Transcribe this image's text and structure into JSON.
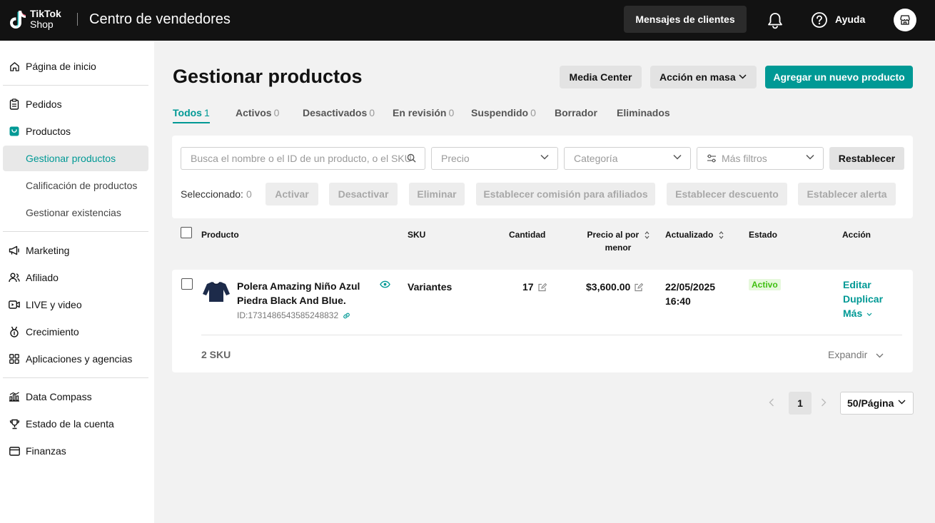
{
  "header": {
    "logo_top": "TikTok",
    "logo_bottom": "Shop",
    "title": "Centro de vendedores",
    "messages_button": "Mensajes de clientes",
    "help_label": "Ayuda"
  },
  "sidebar": {
    "home": "Página de inicio",
    "orders": "Pedidos",
    "products": "Productos",
    "sub_manage": "Gestionar productos",
    "sub_rating": "Calificación de productos",
    "sub_stock": "Gestionar existencias",
    "marketing": "Marketing",
    "affiliate": "Afiliado",
    "live": "LIVE y video",
    "growth": "Crecimiento",
    "apps": "Aplicaciones y agencias",
    "compass": "Data Compass",
    "account": "Estado de la cuenta",
    "finance": "Finanzas"
  },
  "main": {
    "title": "Gestionar productos",
    "media_center": "Media Center",
    "bulk_action": "Acción en masa",
    "add_product": "Agregar un nuevo producto",
    "tabs": [
      {
        "label": "Todos",
        "count": "1"
      },
      {
        "label": "Activos",
        "count": "0"
      },
      {
        "label": "Desactivados",
        "count": "0"
      },
      {
        "label": "En revisión",
        "count": "0"
      },
      {
        "label": "Suspendido",
        "count": "0"
      },
      {
        "label": "Borrador",
        "count": ""
      },
      {
        "label": "Eliminados",
        "count": ""
      }
    ]
  },
  "filters": {
    "search_placeholder": "Busca el nombre o el ID de un producto, o el SKU",
    "price": "Precio",
    "category": "Categoría",
    "more_filters": "Más filtros",
    "reset": "Restablecer",
    "selected_label": "Seleccionado:",
    "selected_count": "0",
    "bulk_buttons": [
      "Activar",
      "Desactivar",
      "Eliminar",
      "Establecer comisión para afiliados",
      "Establecer descuento",
      "Establecer alerta"
    ]
  },
  "table": {
    "headers": {
      "product": "Producto",
      "sku": "SKU",
      "quantity": "Cantidad",
      "price_line1": "Precio al por",
      "price_line2": "menor",
      "updated": "Actualizado",
      "status": "Estado",
      "action": "Acción"
    },
    "rows": [
      {
        "name": "Polera Amazing Niño Azul Piedra Black And Blue.",
        "id": "ID:1731486543585248832",
        "sku": "Variantes",
        "quantity": "17",
        "price": "$3,600.00",
        "updated_date": "22/05/2025",
        "updated_time": "16:40",
        "status": "Activo",
        "actions": [
          "Editar",
          "Duplicar",
          "Más"
        ],
        "sku_count": "2 SKU",
        "expand": "Expandir"
      }
    ]
  },
  "pagination": {
    "current": "1",
    "page_size": "50/Página"
  },
  "colors": {
    "accent": "#009995",
    "header_bg": "#121212",
    "active_badge_bg": "#e6f8dc",
    "active_badge_text": "#3fbf0f"
  }
}
